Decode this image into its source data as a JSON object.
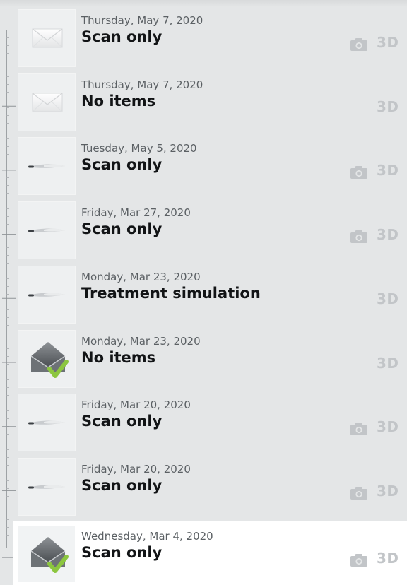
{
  "colors": {
    "background": "#e4e6e7",
    "selected_row": "#ffffff",
    "muted_badge": "#c2c5c8",
    "check_green": "#8cc63f"
  },
  "entries": [
    {
      "date": "Thursday, May 7, 2020",
      "title": "Scan only",
      "thumb_icon": "envelope-icon",
      "has_camera": true,
      "badge": "3D",
      "selected": false
    },
    {
      "date": "Thursday, May 7, 2020",
      "title": "No items",
      "thumb_icon": "envelope-icon",
      "has_camera": false,
      "badge": "3D",
      "selected": false
    },
    {
      "date": "Tuesday, May 5, 2020",
      "title": "Scan only",
      "thumb_icon": "scanner-wand-icon",
      "has_camera": true,
      "badge": "3D",
      "selected": false
    },
    {
      "date": "Friday, Mar 27, 2020",
      "title": "Scan only",
      "thumb_icon": "scanner-wand-icon",
      "has_camera": true,
      "badge": "3D",
      "selected": false
    },
    {
      "date": "Monday, Mar 23, 2020",
      "title": "Treatment simulation",
      "thumb_icon": "scanner-wand-icon",
      "has_camera": false,
      "badge": "3D",
      "selected": false
    },
    {
      "date": "Monday, Mar 23, 2020",
      "title": "No items",
      "thumb_icon": "envelope-check-icon",
      "has_camera": false,
      "badge": "3D",
      "selected": false
    },
    {
      "date": "Friday, Mar 20, 2020",
      "title": "Scan only",
      "thumb_icon": "scanner-wand-icon",
      "has_camera": true,
      "badge": "3D",
      "selected": false
    },
    {
      "date": "Friday, Mar 20, 2020",
      "title": "Scan only",
      "thumb_icon": "scanner-wand-icon",
      "has_camera": true,
      "badge": "3D",
      "selected": false
    },
    {
      "date": "Wednesday, Mar 4, 2020",
      "title": "Scan only",
      "thumb_icon": "envelope-check-icon",
      "has_camera": true,
      "badge": "3D",
      "selected": true
    }
  ]
}
